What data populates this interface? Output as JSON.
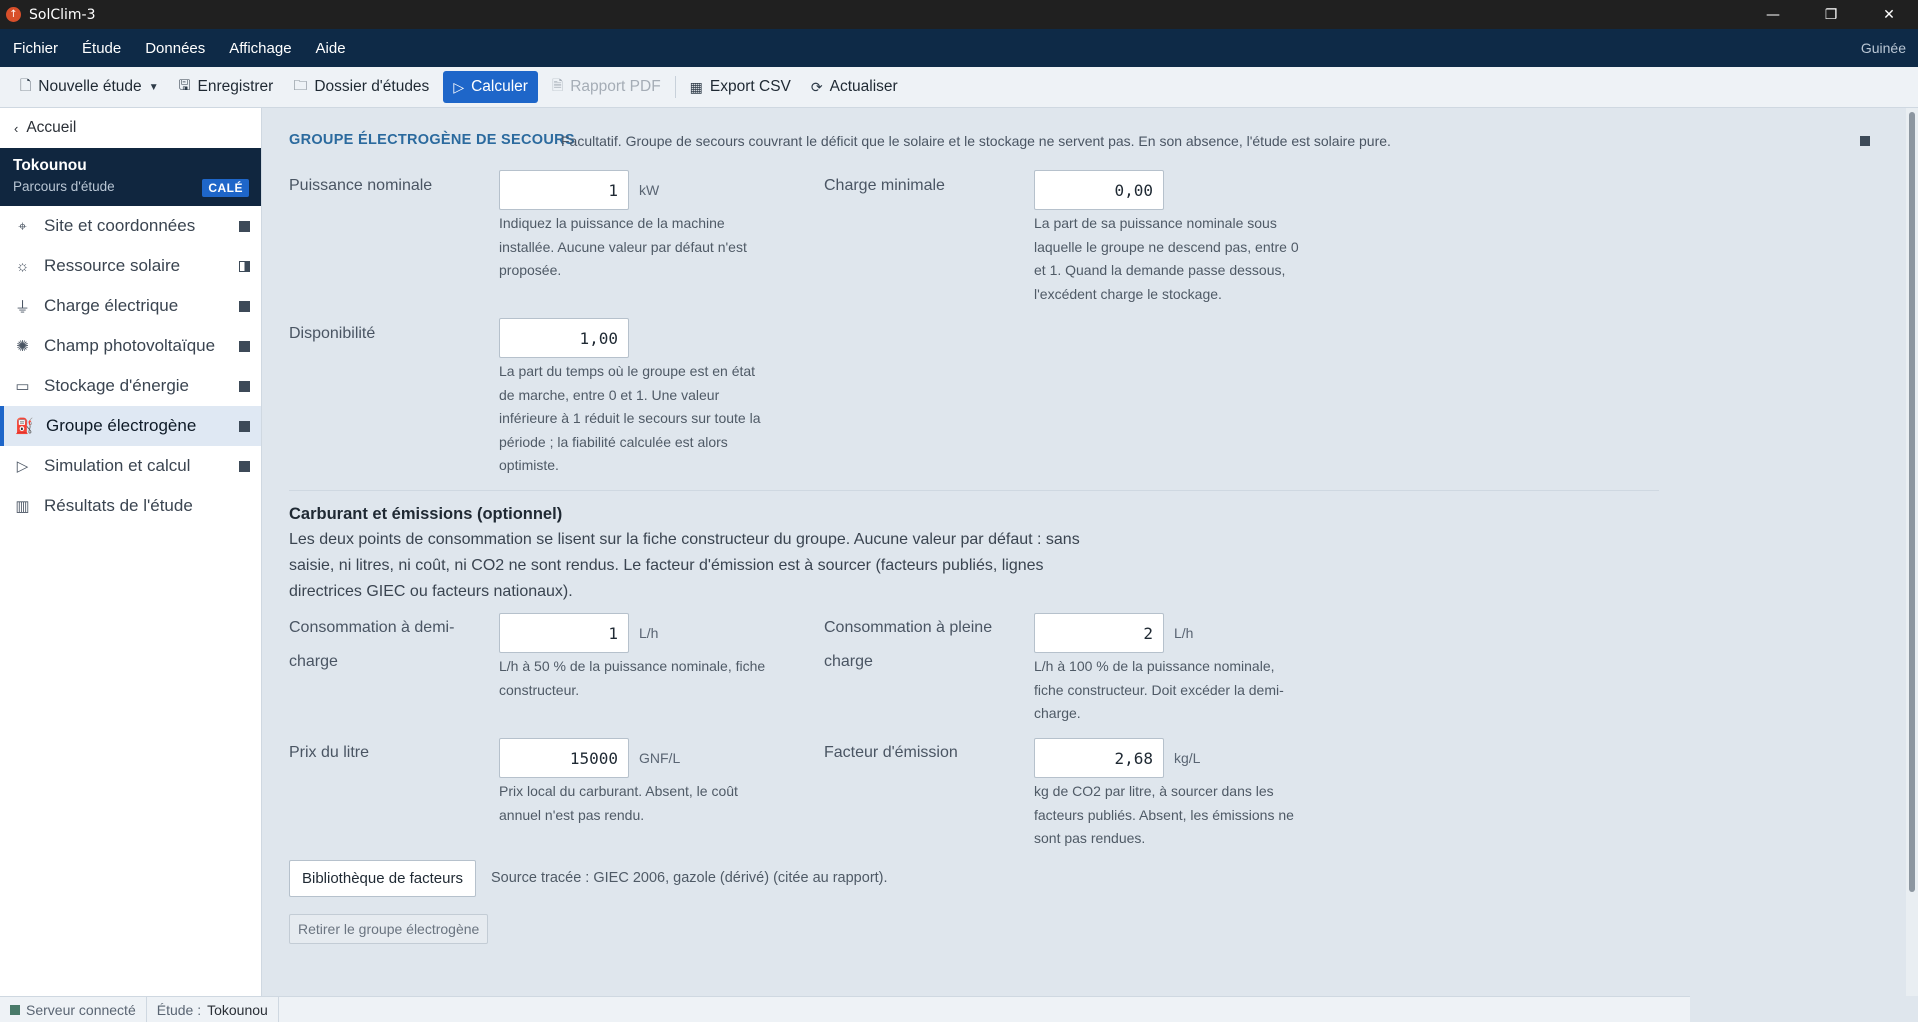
{
  "window": {
    "title": "SolClim-3",
    "controls": [
      "—",
      "❐",
      "✕"
    ]
  },
  "menu": {
    "items": [
      "Fichier",
      "Étude",
      "Données",
      "Affichage",
      "Aide"
    ],
    "country": "Guinée"
  },
  "toolbar": {
    "new_study": "Nouvelle étude",
    "save": "Enregistrer",
    "folder": "Dossier d'études",
    "compute": "Calculer",
    "pdf": "Rapport PDF",
    "csv": "Export CSV",
    "refresh": "Actualiser"
  },
  "sidebar": {
    "back": "Accueil",
    "study_name": "Tokounou",
    "study_sub": "Parcours d'étude",
    "badge": "CALÉ",
    "items": [
      {
        "label": "Site et coordonnées",
        "icon": "pin-icon",
        "state": "full"
      },
      {
        "label": "Ressource solaire",
        "icon": "sun-cloud-icon",
        "state": "half"
      },
      {
        "label": "Charge électrique",
        "icon": "plug-icon",
        "state": "full"
      },
      {
        "label": "Champ photovoltaïque",
        "icon": "sun-icon",
        "state": "full"
      },
      {
        "label": "Stockage d'énergie",
        "icon": "battery-icon",
        "state": "full"
      },
      {
        "label": "Groupe électrogène",
        "icon": "fuel-pump-icon",
        "state": "full"
      },
      {
        "label": "Simulation et calcul",
        "icon": "play-icon",
        "state": "full"
      },
      {
        "label": "Résultats de l'étude",
        "icon": "bar-chart-icon",
        "state": "none"
      }
    ]
  },
  "section": {
    "title": "Groupe électrogène de secours",
    "desc": "Facultatif. Groupe de secours couvrant le déficit que le solaire et le stockage ne servent pas. En son absence, l'étude est solaire pure."
  },
  "fields": {
    "puissance": {
      "label": "Puissance nominale",
      "value": "1",
      "unit": "kW",
      "help": [
        "Indiquez la puissance de la machine",
        "installée. Aucune valeur par défaut n'est",
        "proposée."
      ]
    },
    "charge_min": {
      "label": "Charge minimale",
      "value": "0,00",
      "help": [
        "La part de sa puissance nominale sous",
        "laquelle le groupe ne descend pas, entre 0",
        "et 1. Quand la demande passe dessous,",
        "l'excédent charge le stockage."
      ]
    },
    "dispo": {
      "label": "Disponibilité",
      "value": "1,00",
      "help": [
        "La part du temps où le groupe est en état",
        "de marche, entre 0 et 1. Une valeur",
        "inférieure à 1 réduit le secours sur toute la",
        "période ; la fiabilité calculée est alors",
        "optimiste."
      ]
    }
  },
  "fuel": {
    "title": "Carburant et émissions (optionnel)",
    "desc": [
      "Les deux points de consommation se lisent sur la fiche constructeur du groupe. Aucune valeur par défaut : sans",
      "saisie, ni litres, ni coût, ni CO2 ne sont rendus. Le facteur d'émission est à sourcer (facteurs publiés, lignes",
      "directrices GIEC ou facteurs nationaux)."
    ],
    "demi": {
      "label": [
        "Consommation à demi-",
        "charge"
      ],
      "value": "1",
      "unit": "L/h",
      "help": [
        "L/h à 50 % de la puissance nominale, fiche",
        "constructeur."
      ]
    },
    "pleine": {
      "label": [
        "Consommation à pleine",
        "charge"
      ],
      "value": "2",
      "unit": "L/h",
      "help": [
        "L/h à 100 % de la puissance nominale,",
        "fiche constructeur. Doit excéder la demi-",
        "charge."
      ]
    },
    "prix": {
      "label": "Prix du litre",
      "value": "15000",
      "unit": "GNF/L",
      "help": [
        "Prix local du carburant. Absent, le coût",
        "annuel n'est pas rendu."
      ]
    },
    "facteur": {
      "label": "Facteur d'émission",
      "value": "2,68",
      "unit": "kg/L",
      "help": [
        "kg de CO2 par litre, à sourcer dans les",
        "facteurs publiés. Absent, les émissions ne",
        "sont pas rendues."
      ]
    }
  },
  "library_button": "Bibliothèque de facteurs",
  "source_text": "Source tracée : GIEC 2006, gazole (dérivé) (citée au rapport).",
  "remove_button": "Retirer le groupe électrogène",
  "status": {
    "server": "Serveur connecté",
    "study_label": "Étude :",
    "study_value": "Tokounou"
  }
}
